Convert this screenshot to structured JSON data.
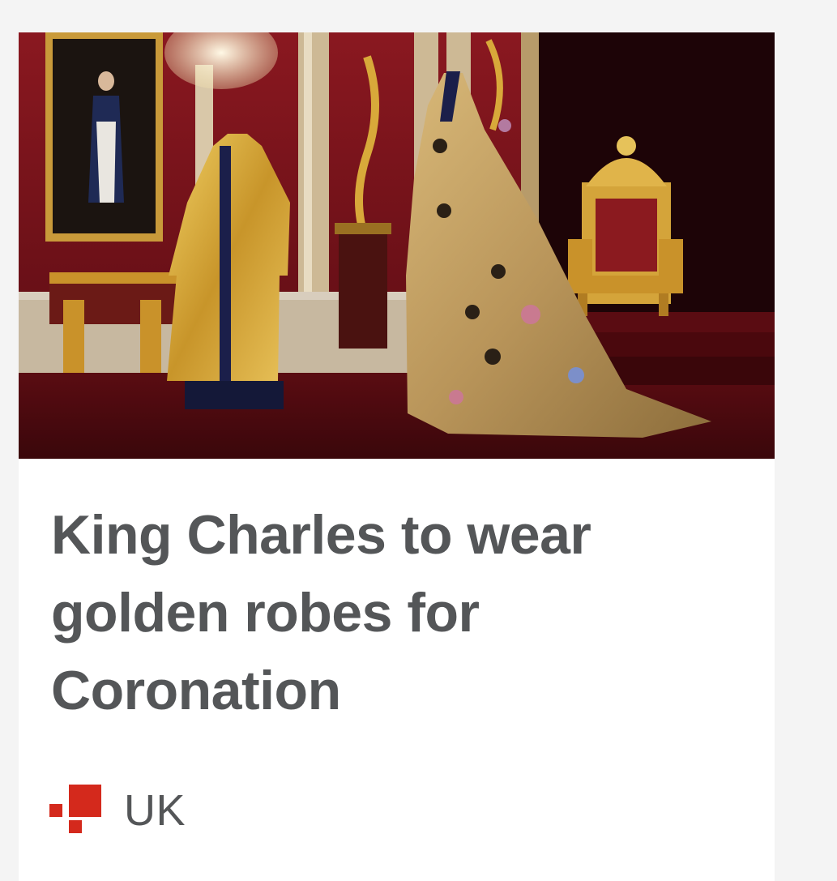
{
  "article": {
    "headline": "King Charles to wear golden robes for Coronation",
    "section": "UK",
    "section_icon": "bbc-news-section-squares-icon",
    "image_alt": "Coronation robes displayed in the Throne Room"
  },
  "colors": {
    "page_bg": "#f4f4f4",
    "card_bg": "#ffffff",
    "headline_text": "#545658",
    "section_accent": "#d4291c"
  }
}
